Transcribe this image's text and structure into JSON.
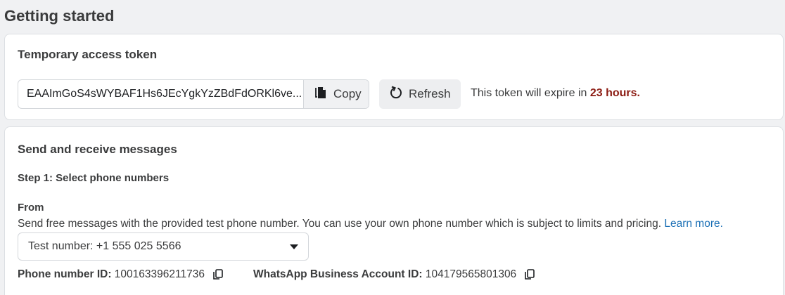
{
  "page": {
    "title": "Getting started"
  },
  "token_card": {
    "title": "Temporary access token",
    "token_value": "EAAImGoS4sWYBAF1Hs6JEcYgkYzZBdFdORKl6ve...",
    "copy_label": "Copy",
    "refresh_label": "Refresh",
    "expiry_prefix": "This token will expire in ",
    "expiry_value": "23 hours.",
    "expiry_color": "#8c1c13"
  },
  "send_card": {
    "title": "Send and receive messages",
    "step1_title": "Step 1: Select phone numbers",
    "from_label": "From",
    "help_text": "Send free messages with the provided test phone number. You can use your own phone number which is subject to limits and pricing. ",
    "learn_more": "Learn more.",
    "link_color": "#1a6fb5",
    "selected_phone": "Test number: +1 555 025 5566",
    "phone_id_label": "Phone number ID:",
    "phone_id_value": "100163396211736",
    "waba_id_label": "WhatsApp Business Account ID:",
    "waba_id_value": "104179565801306"
  },
  "icons": {
    "copy": "copy-icon",
    "refresh": "refresh-icon",
    "dropdown": "chevron-down-icon"
  }
}
